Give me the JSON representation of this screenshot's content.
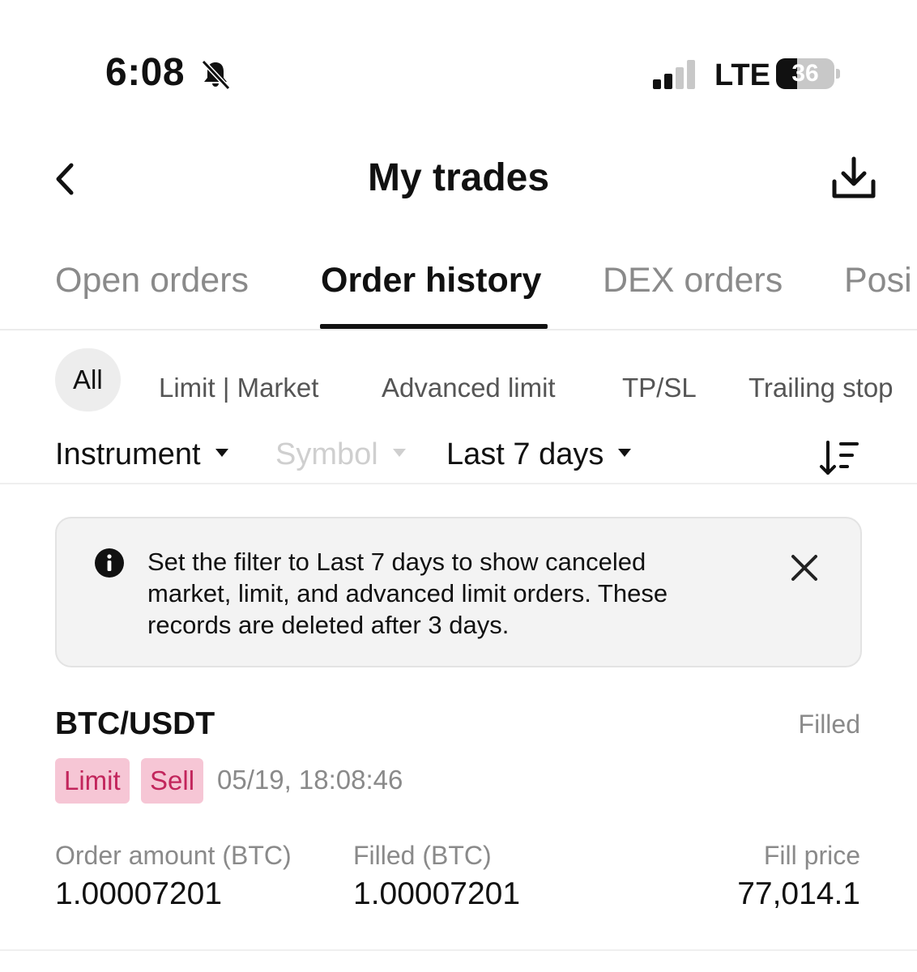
{
  "status_bar": {
    "time": "6:08",
    "network": "LTE",
    "battery_percent": "36",
    "battery_level": 0.36,
    "icons": [
      "bell-slash-icon",
      "signal-icon",
      "battery-icon"
    ]
  },
  "header": {
    "title": "My trades",
    "icons": [
      "back-chevron-icon",
      "download-icon"
    ]
  },
  "tabs": [
    {
      "label": "Open orders",
      "active": false
    },
    {
      "label": "Order history",
      "active": true
    },
    {
      "label": "DEX orders",
      "active": false
    },
    {
      "label": "Posi",
      "active": false
    }
  ],
  "order_types": [
    {
      "label": "All",
      "selected": true
    },
    {
      "label": "Limit | Market",
      "selected": false
    },
    {
      "label": "Advanced limit",
      "selected": false
    },
    {
      "label": "TP/SL",
      "selected": false
    },
    {
      "label": "Trailing stop",
      "selected": false
    }
  ],
  "filters": {
    "instrument": "Instrument",
    "symbol": "Symbol",
    "period": "Last 7 days",
    "sort_icon": "sort-descending-icon"
  },
  "banner": {
    "text": "Set the filter to Last 7 days to show canceled market, limit, and advanced limit orders. These records are deleted after 3 days.",
    "icons": [
      "info-icon",
      "close-icon"
    ]
  },
  "orders": [
    {
      "pair": "BTC/USDT",
      "status": "Filled",
      "order_type": "Limit",
      "side": "Sell",
      "time": "05/19, 18:08:46",
      "amount_label": "Order amount (BTC)",
      "amount_value": "1.00007201",
      "filled_label": "Filled (BTC)",
      "filled_value": "1.00007201",
      "price_label": "Fill price",
      "price_value": "77,014.1"
    }
  ],
  "colors": {
    "tag_background": "#f6c6d5",
    "tag_text": "#c2255c",
    "muted_text": "#8a8a8a",
    "banner_background": "#f3f3f3"
  }
}
